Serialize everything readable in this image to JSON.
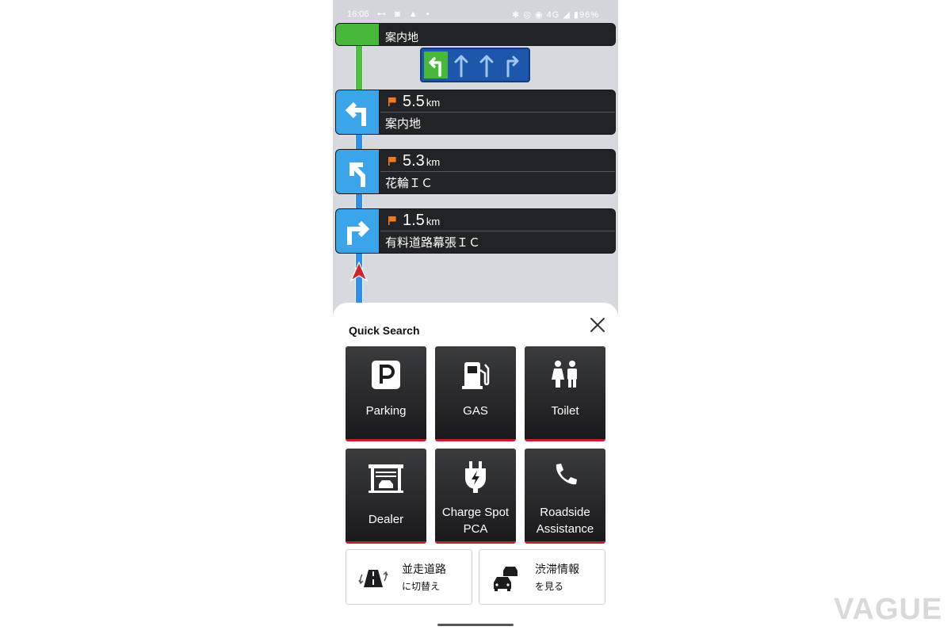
{
  "status_bar": {
    "time": "16:06",
    "network": "4G",
    "battery": "96%"
  },
  "guidance": {
    "top_card": {
      "name": "案内地"
    },
    "cards": [
      {
        "distance": "5.5",
        "unit": "km",
        "name": "案内地",
        "turn": "left"
      },
      {
        "distance": "5.3",
        "unit": "km",
        "name": "花輪ＩＣ",
        "turn": "slight-left"
      },
      {
        "distance": "1.5",
        "unit": "km",
        "name": "有料道路幕張ＩＣ",
        "turn": "right"
      }
    ]
  },
  "quick_search": {
    "title": "Quick Search",
    "tiles": [
      {
        "label": "Parking",
        "icon": "parking-icon"
      },
      {
        "label": "GAS",
        "icon": "gas-station-icon"
      },
      {
        "label": "Toilet",
        "icon": "toilet-icon"
      },
      {
        "label": "Dealer",
        "icon": "dealer-icon"
      },
      {
        "label": "Charge Spot",
        "label2": "PCA",
        "icon": "charge-plug-icon"
      },
      {
        "label": "Roadside",
        "label2": "Assistance",
        "icon": "phone-icon"
      }
    ],
    "buttons": [
      {
        "line1": "並走道路",
        "line2": "に切替え",
        "icon": "parallel-road-icon"
      },
      {
        "line1": "渋滞情報",
        "line2": "を見る",
        "icon": "traffic-jam-icon"
      }
    ]
  },
  "watermark": "VAGUE",
  "colors": {
    "route_green": "#4cc23a",
    "route_blue": "#2f8ff0",
    "sign_blue": "#3aa5e9",
    "accent_red": "#c3202c",
    "flag_orange": "#f07b1a"
  }
}
